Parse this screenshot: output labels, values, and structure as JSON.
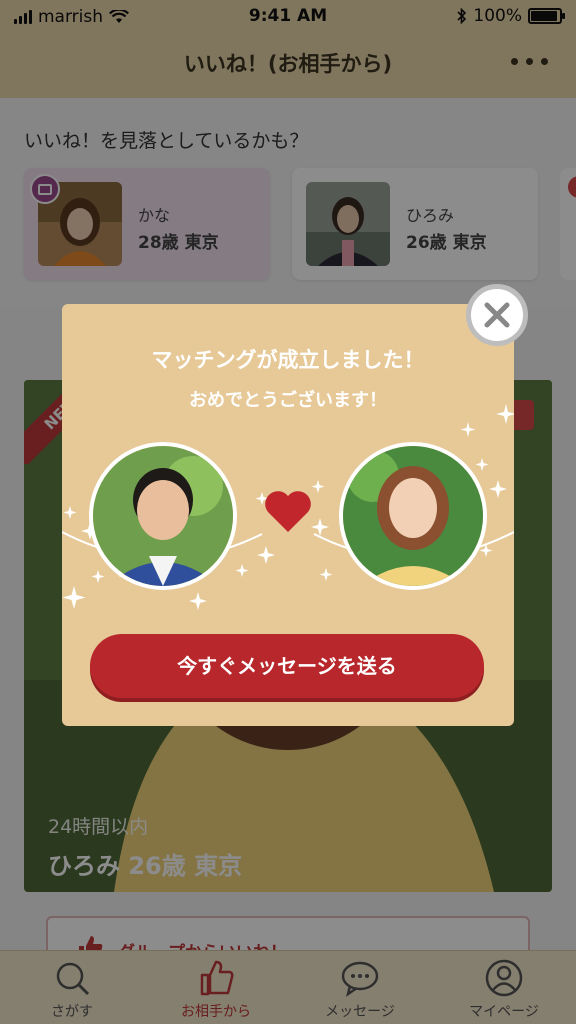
{
  "status_bar": {
    "carrier": "marrish",
    "time": "9:41 AM",
    "battery": "100%"
  },
  "header": {
    "title": "いいね！(お相手から)"
  },
  "missed": {
    "title": "いいね！を見落としているかも？",
    "cards": [
      {
        "name": "かな",
        "info": "28歳 東京"
      },
      {
        "name": "ひろみ",
        "info": "26歳 東京"
      }
    ]
  },
  "card": {
    "badge": "NEW",
    "sub": "24時間以内",
    "name": "ひろみ 26歳 東京",
    "group_label": "グループからいいね！"
  },
  "modal": {
    "title": "マッチングが成立しました！",
    "subtitle": "おめでとうございます！",
    "cta": "今すぐメッセージを送る"
  },
  "tabs": [
    {
      "label": "さがす",
      "icon": "search-icon"
    },
    {
      "label": "お相手から",
      "icon": "thumbs-up-icon"
    },
    {
      "label": "メッセージ",
      "icon": "chat-bubble-icon"
    },
    {
      "label": "マイページ",
      "icon": "person-icon"
    }
  ],
  "colors": {
    "header": "#e9d7aa",
    "modal": "#e7c998",
    "cta": "#b8272b",
    "heart": "#c0262b",
    "active_tab": "#c03a3a"
  }
}
